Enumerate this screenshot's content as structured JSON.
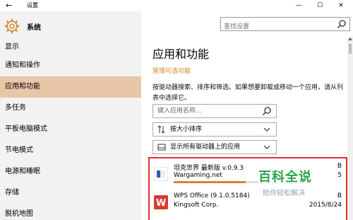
{
  "window": {
    "title": "设置",
    "back_glyph": "←",
    "min_glyph": "—",
    "max_glyph": "☐",
    "close_glyph": "✕"
  },
  "sidebar": {
    "header_label": "系统",
    "items": [
      {
        "label": "显示",
        "active": false
      },
      {
        "label": "通知和操作",
        "active": false
      },
      {
        "label": "应用和功能",
        "active": true
      },
      {
        "label": "多任务",
        "active": false
      },
      {
        "label": "平板电脑模式",
        "active": false
      },
      {
        "label": "节电模式",
        "active": false
      },
      {
        "label": "电源和睡眠",
        "active": false
      },
      {
        "label": "存储",
        "active": false
      },
      {
        "label": "脱机地图",
        "active": false
      }
    ]
  },
  "search": {
    "placeholder": "查找设置"
  },
  "main": {
    "title": "应用和功能",
    "manage_link": "管理可选功能",
    "description": "按驱动器搜索、排序和筛选。如果想要卸载或移动一个应用，请从列表中选择它。",
    "app_search_placeholder": "键入应用名称...",
    "sort_value": "按大小排序",
    "drive_value": "显示所有驱动器上的应用"
  },
  "apps": [
    {
      "name": "坦克世界 最新版 v.0.9.3",
      "publisher": "Wargaming.net",
      "size": "B",
      "date": "5",
      "progress": 0.85
    },
    {
      "name": "WPS Office (9.1.0.5184)",
      "publisher": "Kingsoft Corp.",
      "size": "B",
      "date": "2015/8/24"
    }
  ],
  "watermark": {
    "title": "百科全说",
    "subtitle": "助你轻松解决"
  },
  "colors": {
    "accent": "#d5832b",
    "active_nav": "#e8c6a8",
    "highlight_border": "#e03030",
    "watermark_green": "#2aa34a"
  },
  "icons": {
    "back": "back-arrow-icon",
    "header": "gear-icon",
    "search": "search-icon",
    "app1": "wot-icon",
    "app2": "wps-icon"
  }
}
